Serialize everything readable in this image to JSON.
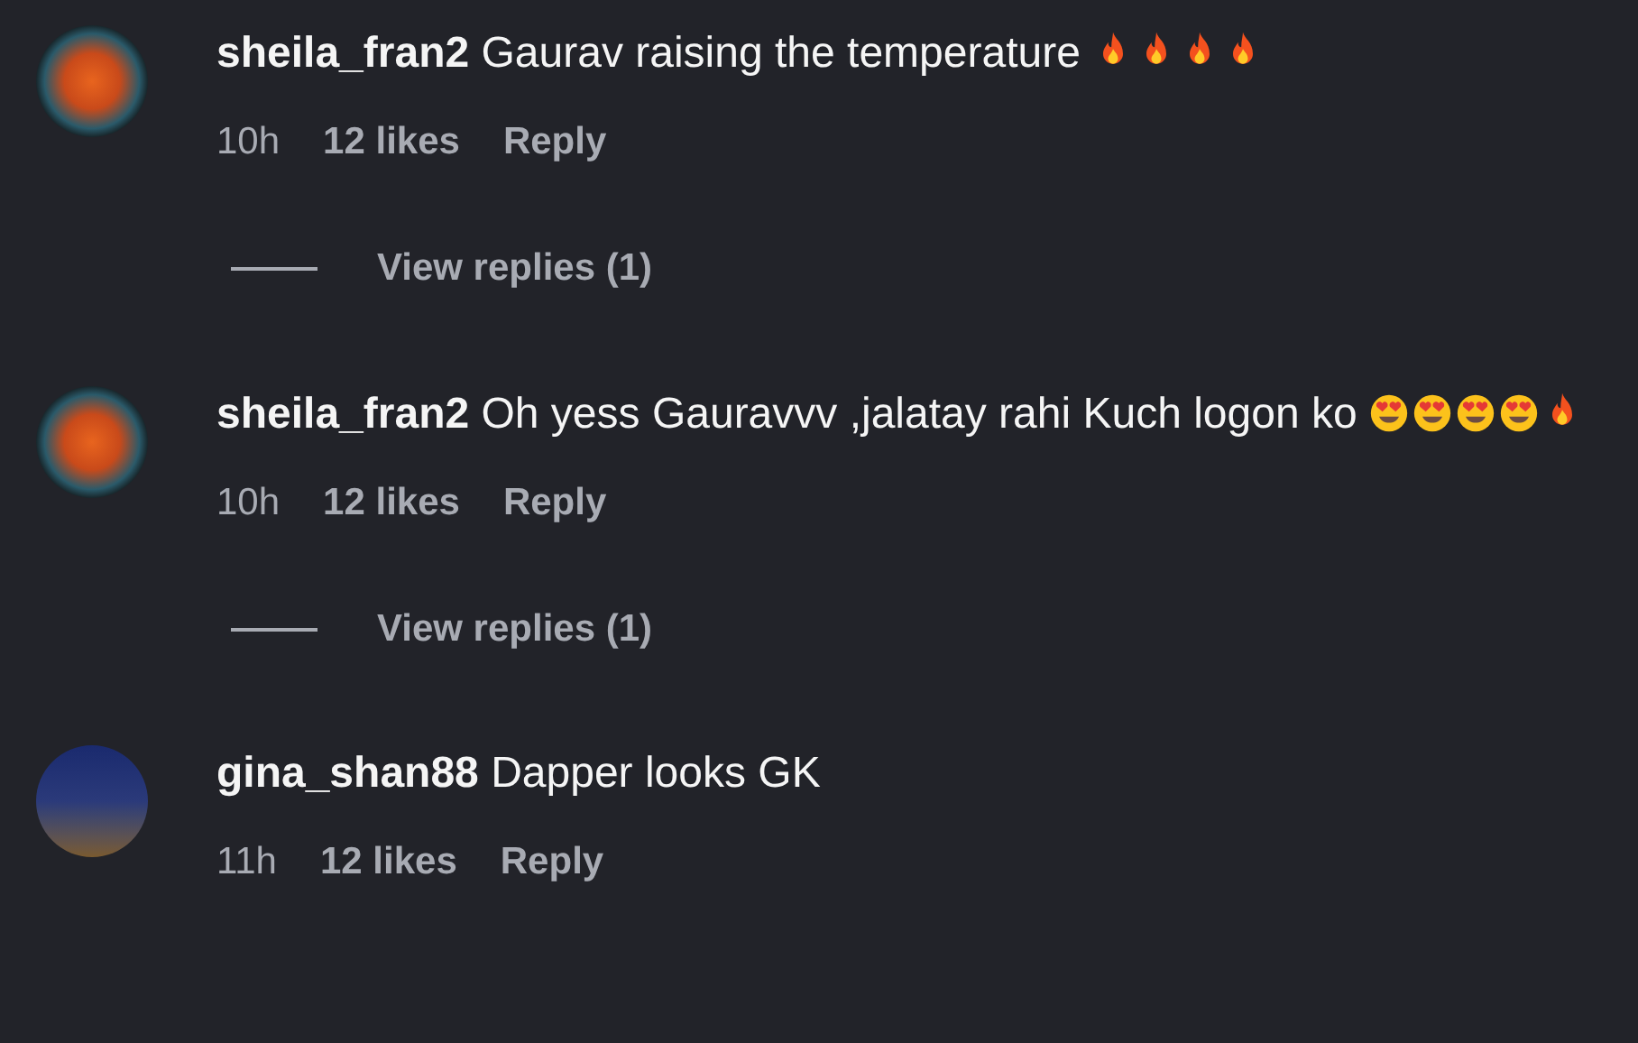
{
  "comments": [
    {
      "username": "sheila_fran2",
      "text": "Gaurav raising the temperature",
      "emojis": [
        {
          "kind": "fire"
        },
        {
          "kind": "fire"
        },
        {
          "kind": "fire"
        },
        {
          "kind": "fire"
        }
      ],
      "time": "10h",
      "likes": "12 likes",
      "reply": "Reply",
      "view_replies": "View replies (1)"
    },
    {
      "username": "sheila_fran2",
      "text": "Oh yess Gauravvv ,jalatay rahi Kuch logon ko",
      "emojis": [
        {
          "kind": "heart-eyes"
        },
        {
          "kind": "heart-eyes"
        },
        {
          "kind": "heart-eyes"
        },
        {
          "kind": "heart-eyes"
        },
        {
          "kind": "fire"
        }
      ],
      "time": "10h",
      "likes": "12 likes",
      "reply": "Reply",
      "view_replies": "View replies (1)"
    },
    {
      "username": "gina_shan88",
      "text": "Dapper looks GK",
      "time": "11h",
      "likes": "12 likes",
      "reply": "Reply"
    }
  ]
}
